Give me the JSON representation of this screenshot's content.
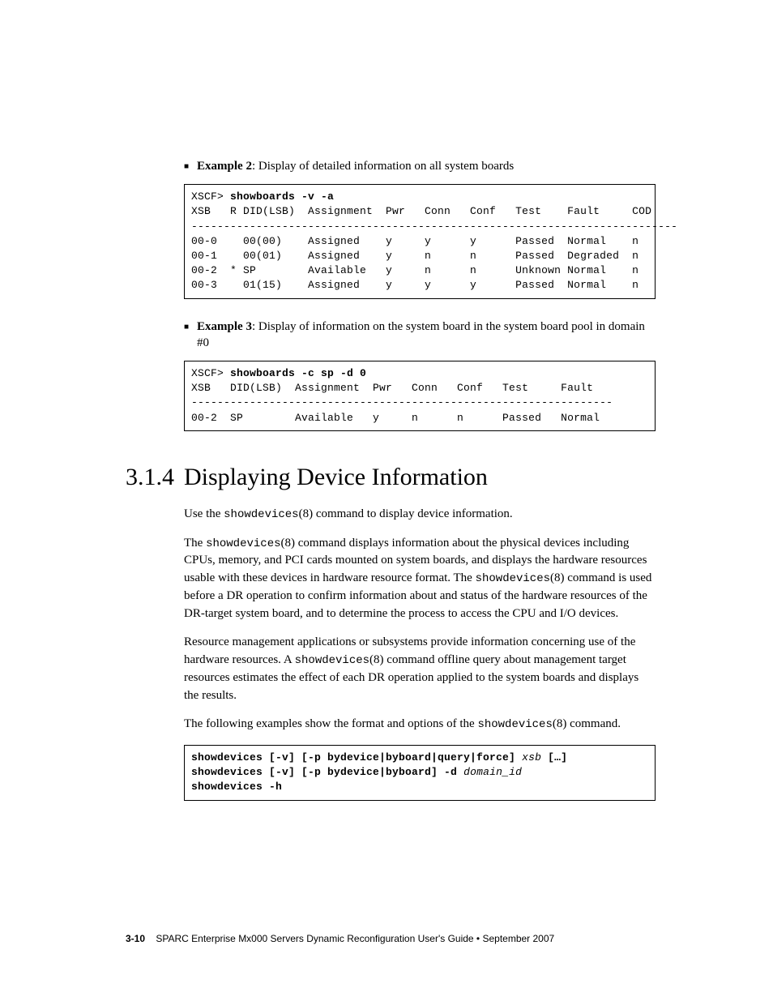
{
  "example2": {
    "label": "Example 2",
    "desc": ": Display of detailed information on all system boards",
    "code_line1_prompt": "XSCF> ",
    "code_line1_cmd": "showboards -v -a",
    "code_body": "XSB   R DID(LSB)  Assignment  Pwr   Conn   Conf   Test    Fault     COD\n---------------------------------------------------------------------------\n00-0    00(00)    Assigned    y     y      y      Passed  Normal    n\n00-1    00(01)    Assigned    y     n      n      Passed  Degraded  n\n00-2  * SP        Available   y     n      n      Unknown Normal    n\n00-3    01(15)    Assigned    y     y      y      Passed  Normal    n"
  },
  "example3": {
    "label": "Example 3",
    "desc": ": Display of information on the system board in the system board pool in domain #0",
    "code_line1_prompt": "XSCF> ",
    "code_line1_cmd": "showboards -c sp -d 0",
    "code_body": "XSB   DID(LSB)  Assignment  Pwr   Conn   Conf   Test     Fault\n-----------------------------------------------------------------\n00-2  SP        Available   y     n      n      Passed   Normal"
  },
  "section": {
    "num": "3.1.4",
    "title": "Displaying Device Information"
  },
  "p1_a": "Use the ",
  "p1_cmd": "showdevices",
  "p1_b": "(8) command to display device information.",
  "p2_a": "The ",
  "p2_cmd1": "showdevices",
  "p2_b": "(8) command displays information about the physical devices including CPUs, memory, and PCI cards mounted on system boards, and displays the hardware resources usable with these devices in hardware resource format. The ",
  "p2_cmd2": "showdevices",
  "p2_c": "(8) command is used before a DR operation to confirm information about and status of the hardware resources of the DR-target system board, and to determine the process to access the CPU and I/O devices.",
  "p3_a": "Resource management applications or subsystems provide information concerning use of the hardware resources. A ",
  "p3_cmd": "showdevices",
  "p3_b": "(8) command offline query about management target resources estimates the effect of each DR operation applied to the system boards and displays the results.",
  "p4_a": "The following examples show the format and options of the ",
  "p4_cmd": "showdevices",
  "p4_b": "(8) command.",
  "syntax": {
    "l1_bold": "showdevices [-v] [-p bydevice|byboard|query|force] ",
    "l1_ital": "xsb",
    "l1_tail": " […]",
    "l2_bold": "showdevices [-v] [-p bydevice|byboard] -d ",
    "l2_ital": "domain_id",
    "l3_bold": "showdevices -h"
  },
  "footer": {
    "page": "3-10",
    "text": "SPARC Enterprise Mx000 Servers Dynamic Reconfiguration User's Guide • September 2007"
  }
}
